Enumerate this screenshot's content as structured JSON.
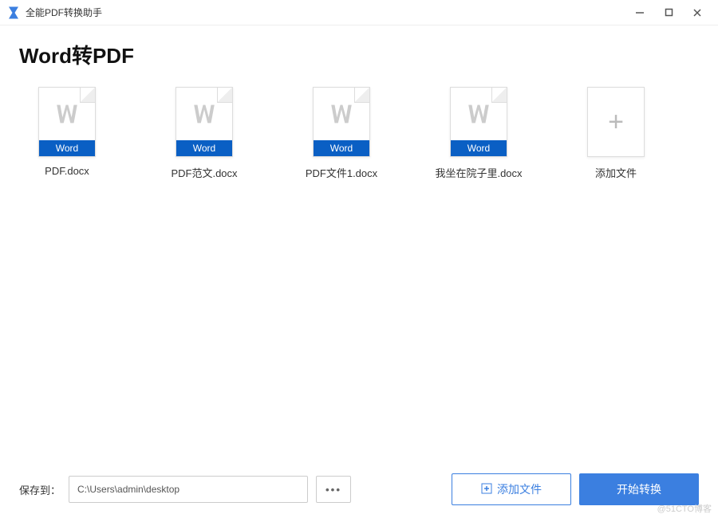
{
  "titlebar": {
    "app_title": "全能PDF转换助手"
  },
  "page": {
    "title": "Word转PDF"
  },
  "files": [
    {
      "name": "PDF.docx",
      "badge": "Word"
    },
    {
      "name": "PDF范文.docx",
      "badge": "Word"
    },
    {
      "name": "PDF文件1.docx",
      "badge": "Word"
    },
    {
      "name": "我坐在院子里.docx",
      "badge": "Word"
    }
  ],
  "add_file_card": {
    "label": "添加文件"
  },
  "bottom": {
    "save_to_label": "保存到：",
    "path_value": "C:\\Users\\admin\\desktop",
    "add_file_button": "添加文件",
    "start_button": "开始转换"
  },
  "watermark": "@51CTO博客",
  "colors": {
    "primary": "#3b7fe0",
    "badge": "#0a5fc4"
  }
}
